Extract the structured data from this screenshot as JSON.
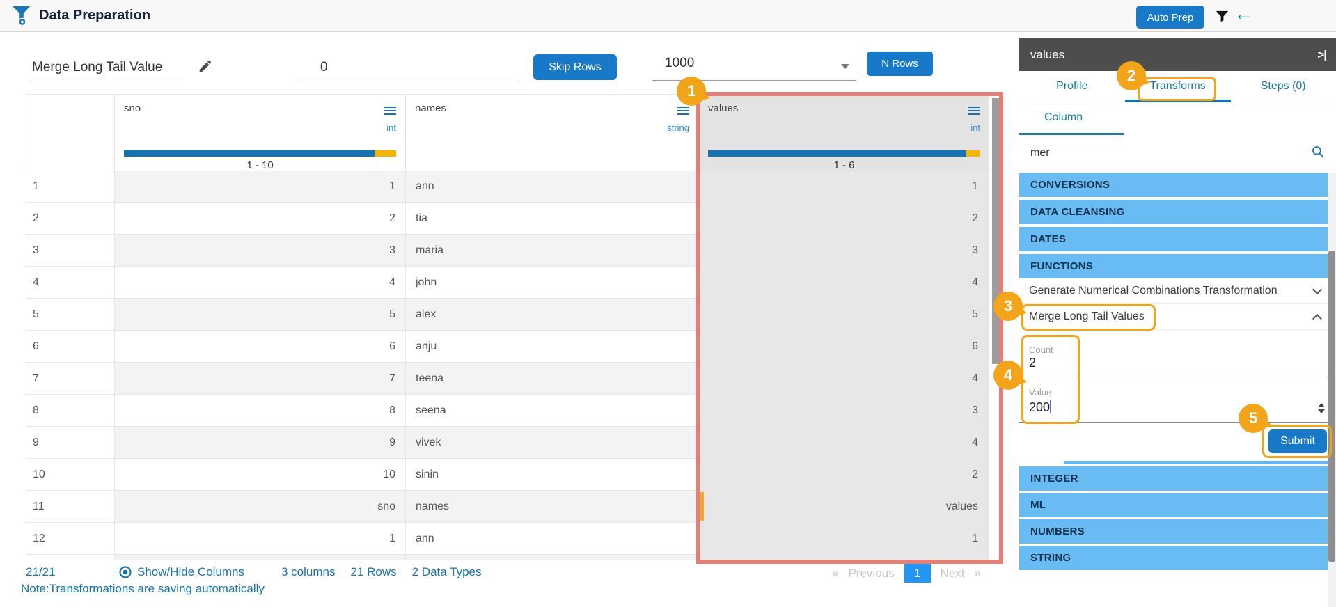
{
  "header": {
    "title": "Data Preparation",
    "auto_prep": "Auto Prep"
  },
  "toolbar": {
    "dataset_name": "Merge Long Tail Value",
    "skip_rows_value": "0",
    "skip_rows_button": "Skip Rows",
    "n_rows_value": "1000",
    "n_rows_button": "N Rows"
  },
  "table": {
    "columns": [
      {
        "key": "sno",
        "label": "sno",
        "type": "int",
        "range": "1 - 10",
        "bar_blue_pct": 92,
        "selected": false
      },
      {
        "key": "names",
        "label": "names",
        "type": "string",
        "range": "",
        "bar_blue_pct": null,
        "selected": false
      },
      {
        "key": "values",
        "label": "values",
        "type": "int",
        "range": "1 - 6",
        "bar_blue_pct": 95,
        "selected": true
      }
    ],
    "rows": [
      {
        "idx": "1",
        "sno": "1",
        "names": "ann",
        "values": "1"
      },
      {
        "idx": "2",
        "sno": "2",
        "names": "tia",
        "values": "2"
      },
      {
        "idx": "3",
        "sno": "3",
        "names": "maria",
        "values": "3"
      },
      {
        "idx": "4",
        "sno": "4",
        "names": "john",
        "values": "4"
      },
      {
        "idx": "5",
        "sno": "5",
        "names": "alex",
        "values": "5"
      },
      {
        "idx": "6",
        "sno": "6",
        "names": "anju",
        "values": "6"
      },
      {
        "idx": "7",
        "sno": "7",
        "names": "teena",
        "values": "4"
      },
      {
        "idx": "8",
        "sno": "8",
        "names": "seena",
        "values": "3"
      },
      {
        "idx": "9",
        "sno": "9",
        "names": "vivek",
        "values": "4"
      },
      {
        "idx": "10",
        "sno": "10",
        "names": "sinin",
        "values": "2"
      },
      {
        "idx": "11",
        "sno": "sno",
        "names": "names",
        "values": "values",
        "marker": true
      },
      {
        "idx": "12",
        "sno": "1",
        "names": "ann",
        "values": "1"
      }
    ]
  },
  "footer": {
    "row_count": "21/21",
    "show_hide": "Show/Hide Columns",
    "columns_summary": "3 columns",
    "rows_summary": "21 Rows",
    "types_summary": "2 Data Types",
    "note": "Note:Transformations are saving automatically",
    "pagination": {
      "prev_arrow": "«",
      "previous": "Previous",
      "page": "1",
      "next": "Next",
      "next_arrow": "»"
    }
  },
  "sidebar": {
    "column_title": "values",
    "collapse_icon": ">|",
    "tabs": [
      "Profile",
      "Transforms",
      "Steps (0)"
    ],
    "active_tab": "Transforms",
    "subtab": "Column",
    "search_value": "mer",
    "top_categories": [
      "CONVERSIONS",
      "DATA CLEANSING",
      "DATES",
      "FUNCTIONS"
    ],
    "transform_items": [
      {
        "label": "Generate Numerical Combinations Transformation",
        "expanded": false
      },
      {
        "label": "Merge Long Tail Values",
        "expanded": true
      }
    ],
    "form": {
      "count_label": "Count",
      "count_value": "2",
      "value_label": "Value",
      "value_value": "200",
      "submit": "Submit"
    },
    "bottom_categories": [
      "INTEGER",
      "ML",
      "NUMBERS",
      "STRING"
    ]
  },
  "annotations": {
    "steps": [
      "1",
      "2",
      "3",
      "4",
      "5"
    ]
  },
  "colors": {
    "primary_blue": "#1779C8",
    "category_blue": "#69BCF3",
    "accent_orange": "#F2A41B",
    "column_highlight_red": "#E08078",
    "bar_blue": "#1673B1",
    "bar_yellow": "#F2B500",
    "tab_teal": "#1B7A9E",
    "link_blue": "#1673B1"
  }
}
